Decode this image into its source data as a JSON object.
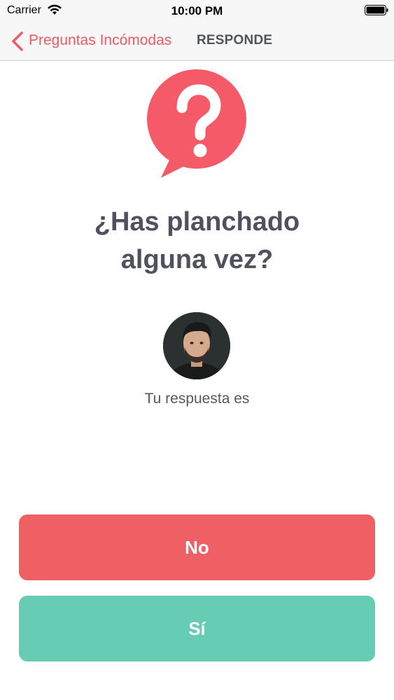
{
  "status_bar": {
    "carrier": "Carrier",
    "time": "10:00 PM",
    "wifi_icon": "wifi-icon",
    "battery_icon": "battery-icon"
  },
  "nav": {
    "back_label": "Preguntas Incómodas",
    "title": "RESPONDE",
    "accent_color": "#ef5a63"
  },
  "question": {
    "icon": "question-bubble-icon",
    "icon_color": "#f45a67",
    "line1": "¿Has planchado",
    "line2": "alguna vez?"
  },
  "user": {
    "avatar": "avatar"
  },
  "answer": {
    "prompt": "Tu respuesta es",
    "no_label": "No",
    "no_color": "#ee6063",
    "yes_label": "Sí",
    "yes_color": "#66ccb3"
  }
}
